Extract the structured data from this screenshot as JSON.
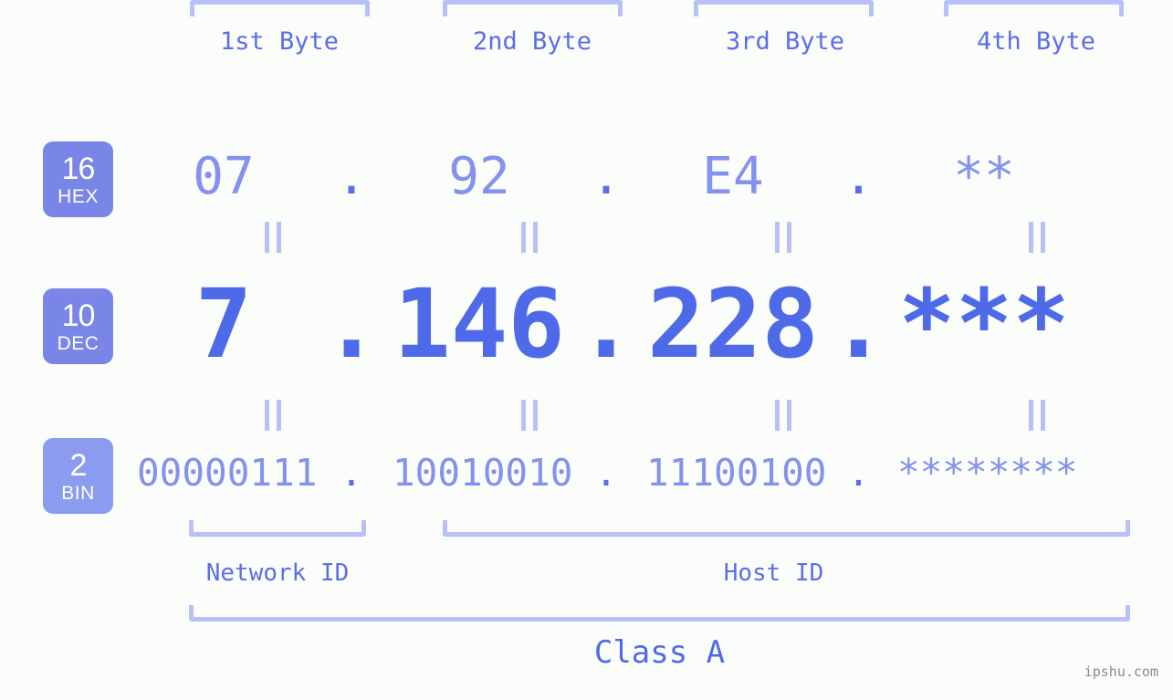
{
  "meta": {
    "background_color": "#fbfdfa",
    "accent_color": "#4f6ae8",
    "light_accent_color": "#8391ef",
    "bracket_color": "#b7c0f9",
    "badge_color": "#7986e8",
    "badge_color_bin": "#8b9cf0",
    "watermark": "ipshu.com"
  },
  "headers": [
    {
      "label": "1st Byte"
    },
    {
      "label": "2nd Byte"
    },
    {
      "label": "3rd Byte"
    },
    {
      "label": "4th Byte"
    }
  ],
  "bases": [
    {
      "number": "16",
      "name": "HEX"
    },
    {
      "number": "10",
      "name": "DEC"
    },
    {
      "number": "2",
      "name": "BIN"
    }
  ],
  "rows": {
    "hex": {
      "base_number": "16",
      "base_name": "HEX",
      "values": [
        "07",
        "92",
        "E4",
        "**"
      ],
      "separator": "."
    },
    "dec": {
      "base_number": "10",
      "base_name": "DEC",
      "values": [
        "7",
        "146",
        "228",
        "***"
      ],
      "separator": "."
    },
    "bin": {
      "base_number": "2",
      "base_name": "BIN",
      "values": [
        "00000111",
        "10010010",
        "11100100",
        "********"
      ],
      "separator": "."
    }
  },
  "equals_marks": {
    "symbol": "||",
    "count_per_gap": 4
  },
  "segments": {
    "network_id": "Network ID",
    "host_id": "Host ID",
    "class": "Class A"
  }
}
